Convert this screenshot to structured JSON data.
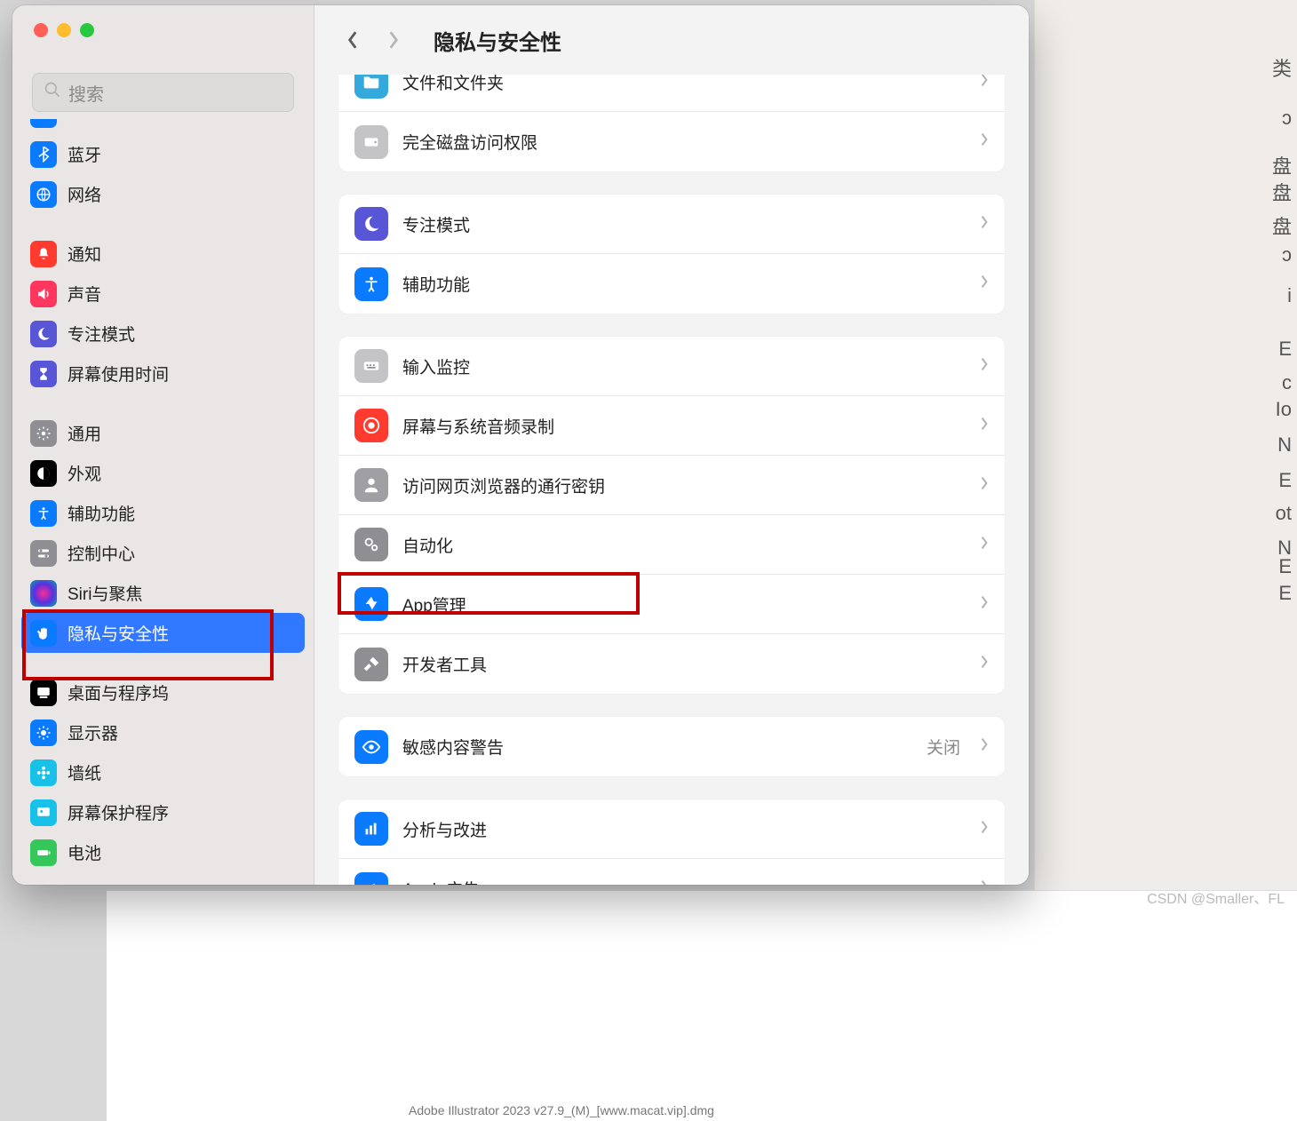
{
  "window": {
    "title": "隐私与安全性",
    "search_placeholder": "搜索"
  },
  "sidebar": {
    "items": [
      {
        "label": "蓝牙",
        "icon": "bluetooth",
        "color": "#0a7aff"
      },
      {
        "label": "网络",
        "icon": "globe",
        "color": "#0a7aff"
      },
      {
        "label": "通知",
        "icon": "bell",
        "color": "#ff3b30"
      },
      {
        "label": "声音",
        "icon": "speaker",
        "color": "#ff375f"
      },
      {
        "label": "专注模式",
        "icon": "moon",
        "color": "#5856d6"
      },
      {
        "label": "屏幕使用时间",
        "icon": "hourglass",
        "color": "#5856d6"
      },
      {
        "label": "通用",
        "icon": "gear",
        "color": "#8e8e93"
      },
      {
        "label": "外观",
        "icon": "appearance",
        "color": "#000000"
      },
      {
        "label": "辅助功能",
        "icon": "accessibility",
        "color": "#0a7aff"
      },
      {
        "label": "控制中心",
        "icon": "switches",
        "color": "#8e8e93"
      },
      {
        "label": "Siri与聚焦",
        "icon": "siri",
        "color": "#1c1c1e"
      },
      {
        "label": "隐私与安全性",
        "icon": "hand",
        "color": "#0a7aff",
        "selected": true
      },
      {
        "label": "桌面与程序坞",
        "icon": "dock",
        "color": "#000000"
      },
      {
        "label": "显示器",
        "icon": "sun",
        "color": "#0a7aff"
      },
      {
        "label": "墙纸",
        "icon": "flower",
        "color": "#17c1e8"
      },
      {
        "label": "屏幕保护程序",
        "icon": "screensaver",
        "color": "#17c1e8"
      },
      {
        "label": "电池",
        "icon": "battery",
        "color": "#34c759"
      }
    ]
  },
  "content": {
    "groups": [
      {
        "rows": [
          {
            "label": "文件和文件夹",
            "icon": "folder",
            "color": "#34aadc"
          },
          {
            "label": "完全磁盘访问权限",
            "icon": "disk",
            "color": "#8e8e93"
          }
        ]
      },
      {
        "rows": [
          {
            "label": "专注模式",
            "icon": "moon",
            "color": "#5856d6"
          },
          {
            "label": "辅助功能",
            "icon": "accessibility",
            "color": "#0a7aff"
          }
        ]
      },
      {
        "rows": [
          {
            "label": "输入监控",
            "icon": "keyboard",
            "color": "#8e8e93"
          },
          {
            "label": "屏幕与系统音频录制",
            "icon": "record",
            "color": "#ff3b30"
          },
          {
            "label": "访问网页浏览器的通行密钥",
            "icon": "person",
            "color": "#8e8e93"
          },
          {
            "label": "自动化",
            "icon": "gears",
            "color": "#8e8e93"
          },
          {
            "label": "App管理",
            "icon": "appstore",
            "color": "#0a7aff",
            "highlight": true
          },
          {
            "label": "开发者工具",
            "icon": "hammer",
            "color": "#8e8e93"
          }
        ]
      },
      {
        "rows": [
          {
            "label": "敏感内容警告",
            "icon": "eye",
            "color": "#0a7aff",
            "value": "关闭"
          }
        ]
      },
      {
        "rows": [
          {
            "label": "分析与改进",
            "icon": "chart",
            "color": "#0a7aff"
          },
          {
            "label": "Apple广告",
            "icon": "megaphone",
            "color": "#0a7aff"
          }
        ]
      }
    ]
  },
  "outside": {
    "watermark": "CSDN @Smaller、FL",
    "bottom_text": "Adobe Illustrator 2023 v27.9_(M)_[www.macat.vip].dmg"
  }
}
